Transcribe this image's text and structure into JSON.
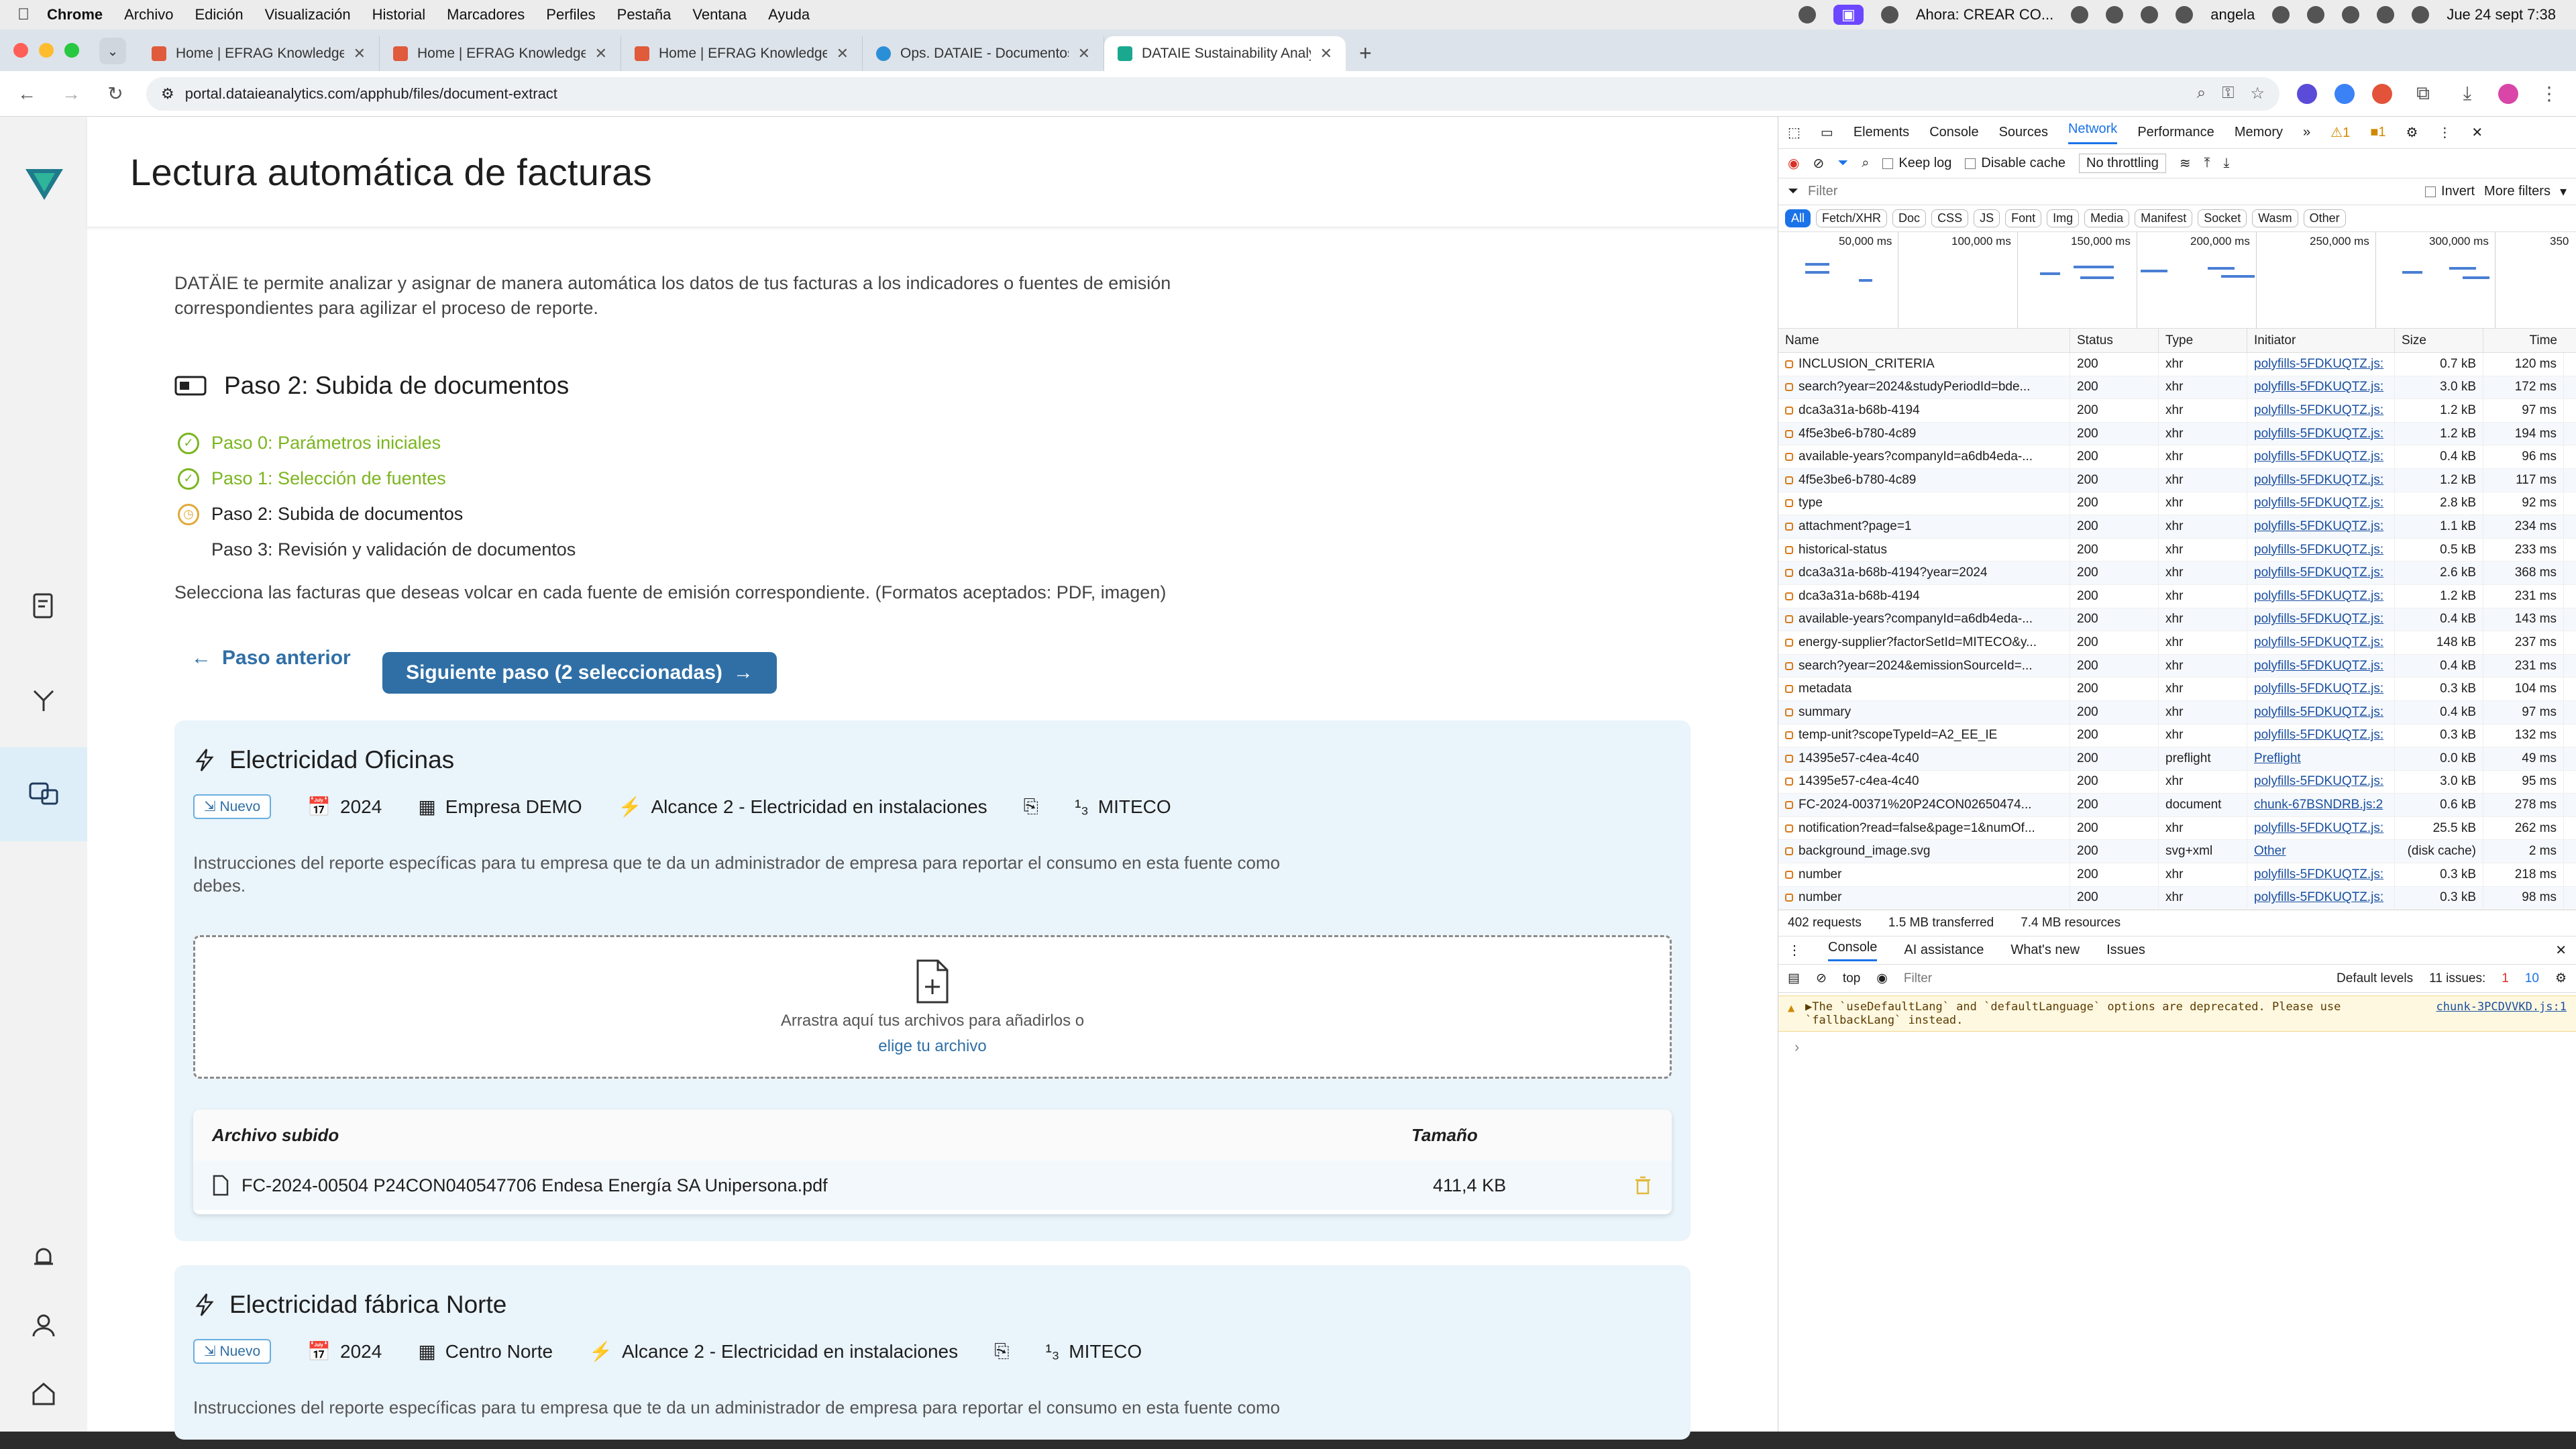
{
  "menubar": {
    "app": "Chrome",
    "items": [
      "Archivo",
      "Edición",
      "Visualización",
      "Historial",
      "Marcadores",
      "Perfiles",
      "Pestaña",
      "Ventana",
      "Ayuda"
    ],
    "now_playing": "Ahora: CREAR CO...",
    "user": "angela",
    "datetime": "Jue 24 sept 7:38"
  },
  "tabs": [
    {
      "title": "Home | EFRAG Knowledge Hu..."
    },
    {
      "title": "Home | EFRAG Knowledge Hu..."
    },
    {
      "title": "Home | EFRAG Knowledge Hu..."
    },
    {
      "title": "Ops. DATAIE - Documentos -..."
    },
    {
      "title": "DATAIE Sustainability Analytic..."
    }
  ],
  "address": {
    "url": "portal.dataieanalytics.com/apphub/files/document-extract"
  },
  "page": {
    "title": "Lectura automática de facturas",
    "intro": "DATÄIE te permite analizar y asignar de manera automática los datos de tus facturas a los indicadores o fuentes de emisión correspondientes para agilizar el proceso de reporte.",
    "step_title": "Paso 2: Subida de documentos",
    "steps": [
      {
        "label": "Paso 0: Parámetros iniciales"
      },
      {
        "label": "Paso 1: Selección de fuentes"
      },
      {
        "label": "Paso 2: Subida de documentos"
      },
      {
        "label": "Paso 3: Revisión y validación de documentos"
      }
    ],
    "select_text": "Selecciona las facturas que deseas volcar en cada fuente de emisión correspondiente. (Formatos aceptados: PDF, imagen)",
    "back_label": "Paso anterior",
    "next_label": "Siguiente paso (2 seleccionadas)"
  },
  "cards": [
    {
      "title": "Electricidad Oficinas",
      "badge": "Nuevo",
      "year": "2024",
      "company": "Empresa DEMO",
      "scope": "Alcance 2 - Electricidad en instalaciones",
      "source": "MITECO",
      "instructions": "Instrucciones del reporte específicas para tu empresa que te da un administrador de empresa para reportar el consumo en esta fuente como debes.",
      "dropzone_text": "Arrastra aquí tus archivos para añadirlos o",
      "dropzone_link": "elige tu archivo",
      "col_file": "Archivo subido",
      "col_size": "Tamaño",
      "file_name": "FC-2024-00504 P24CON040547706 Endesa Energía SA Unipersona.pdf",
      "file_size": "411,4 KB"
    },
    {
      "title": "Electricidad fábrica Norte",
      "badge": "Nuevo",
      "year": "2024",
      "company": "Centro Norte",
      "scope": "Alcance 2 - Electricidad en instalaciones",
      "source": "MITECO",
      "instructions": "Instrucciones del reporte específicas para tu empresa que te da un administrador de empresa para reportar el consumo en esta fuente como debes."
    }
  ],
  "devtools": {
    "tabs": [
      "Elements",
      "Console",
      "Sources",
      "Network",
      "Performance",
      "Memory"
    ],
    "issues_warn": "1",
    "issues_err": "1",
    "keep_log": "Keep log",
    "disable_cache": "Disable cache",
    "throttling": "No throttling",
    "filter": "Filter",
    "invert": "Invert",
    "more_filters": "More filters",
    "types": [
      "All",
      "Fetch/XHR",
      "Doc",
      "CSS",
      "JS",
      "Font",
      "Img",
      "Media",
      "Manifest",
      "Socket",
      "Wasm",
      "Other"
    ],
    "timeline_labels": [
      "50,000 ms",
      "100,000 ms",
      "150,000 ms",
      "200,000 ms",
      "250,000 ms",
      "300,000 ms",
      "350"
    ],
    "columns": [
      "Name",
      "Status",
      "Type",
      "Initiator",
      "Size",
      "Time"
    ],
    "rows": [
      [
        "INCLUSION_CRITERIA",
        "200",
        "xhr",
        "polyfills-5FDKUQTZ.js:",
        "0.7 kB",
        "120 ms"
      ],
      [
        "search?year=2024&studyPeriodId=bde...",
        "200",
        "xhr",
        "polyfills-5FDKUQTZ.js:",
        "3.0 kB",
        "172 ms"
      ],
      [
        "dca3a31a-b68b-4194",
        "200",
        "xhr",
        "polyfills-5FDKUQTZ.js:",
        "1.2 kB",
        "97 ms"
      ],
      [
        "4f5e3be6-b780-4c89",
        "200",
        "xhr",
        "polyfills-5FDKUQTZ.js:",
        "1.2 kB",
        "194 ms"
      ],
      [
        "available-years?companyId=a6db4eda-...",
        "200",
        "xhr",
        "polyfills-5FDKUQTZ.js:",
        "0.4 kB",
        "96 ms"
      ],
      [
        "4f5e3be6-b780-4c89",
        "200",
        "xhr",
        "polyfills-5FDKUQTZ.js:",
        "1.2 kB",
        "117 ms"
      ],
      [
        "type",
        "200",
        "xhr",
        "polyfills-5FDKUQTZ.js:",
        "2.8 kB",
        "92 ms"
      ],
      [
        "attachment?page=1",
        "200",
        "xhr",
        "polyfills-5FDKUQTZ.js:",
        "1.1 kB",
        "234 ms"
      ],
      [
        "historical-status",
        "200",
        "xhr",
        "polyfills-5FDKUQTZ.js:",
        "0.5 kB",
        "233 ms"
      ],
      [
        "dca3a31a-b68b-4194?year=2024",
        "200",
        "xhr",
        "polyfills-5FDKUQTZ.js:",
        "2.6 kB",
        "368 ms"
      ],
      [
        "dca3a31a-b68b-4194",
        "200",
        "xhr",
        "polyfills-5FDKUQTZ.js:",
        "1.2 kB",
        "231 ms"
      ],
      [
        "available-years?companyId=a6db4eda-...",
        "200",
        "xhr",
        "polyfills-5FDKUQTZ.js:",
        "0.4 kB",
        "143 ms"
      ],
      [
        "energy-supplier?factorSetId=MITECO&y...",
        "200",
        "xhr",
        "polyfills-5FDKUQTZ.js:",
        "148 kB",
        "237 ms"
      ],
      [
        "search?year=2024&emissionSourceId=...",
        "200",
        "xhr",
        "polyfills-5FDKUQTZ.js:",
        "0.4 kB",
        "231 ms"
      ],
      [
        "metadata",
        "200",
        "xhr",
        "polyfills-5FDKUQTZ.js:",
        "0.3 kB",
        "104 ms"
      ],
      [
        "summary",
        "200",
        "xhr",
        "polyfills-5FDKUQTZ.js:",
        "0.4 kB",
        "97 ms"
      ],
      [
        "temp-unit?scopeTypeId=A2_EE_IE",
        "200",
        "xhr",
        "polyfills-5FDKUQTZ.js:",
        "0.3 kB",
        "132 ms"
      ],
      [
        "14395e57-c4ea-4c40",
        "200",
        "preflight",
        "Preflight",
        "0.0 kB",
        "49 ms"
      ],
      [
        "14395e57-c4ea-4c40",
        "200",
        "xhr",
        "polyfills-5FDKUQTZ.js:",
        "3.0 kB",
        "95 ms"
      ],
      [
        "FC-2024-00371%20P24CON02650474...",
        "200",
        "document",
        "chunk-67BSNDRB.js:2",
        "0.6 kB",
        "278 ms"
      ],
      [
        "notification?read=false&page=1&numOf...",
        "200",
        "xhr",
        "polyfills-5FDKUQTZ.js:",
        "25.5 kB",
        "262 ms"
      ],
      [
        "background_image.svg",
        "200",
        "svg+xml",
        "Other",
        "(disk cache)",
        "2 ms"
      ],
      [
        "number",
        "200",
        "xhr",
        "polyfills-5FDKUQTZ.js:",
        "0.3 kB",
        "218 ms"
      ],
      [
        "number",
        "200",
        "xhr",
        "polyfills-5FDKUQTZ.js:",
        "0.3 kB",
        "98 ms"
      ]
    ],
    "summary_requests": "402 requests",
    "summary_transferred": "1.5 MB transferred",
    "summary_resources": "7.4 MB resources",
    "console_tabs": [
      "Console",
      "AI assistance",
      "What's new",
      "Issues"
    ],
    "context": "top",
    "default_levels": "Default levels",
    "issues_count": "11 issues:",
    "issues_a": "1",
    "issues_b": "10",
    "warning": "▶The `useDefaultLang` and `defaultLanguage` options are deprecated. Please use `fallbackLang` instead.",
    "warning_src": "chunk-3PCDVVKD.js:1",
    "prompt": "›"
  },
  "colors": {
    "accent": "#2F6FA6",
    "green": "#7BB51F",
    "pending": "#E2A93B",
    "card": "#EAF4FB"
  }
}
